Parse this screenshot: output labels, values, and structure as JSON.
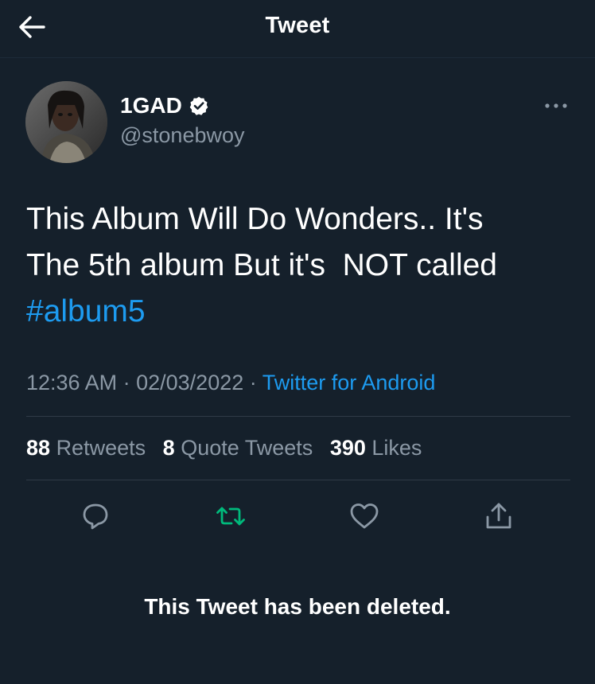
{
  "header": {
    "title": "Tweet",
    "back_icon": "arrow-left-icon"
  },
  "author": {
    "display_name": "1GAD",
    "handle": "@stonebwoy",
    "verified": true,
    "verified_icon": "verified-badge-icon"
  },
  "tweet": {
    "text_line_1": "This Album Will Do Wonders.. It's",
    "text_line_2": "The 5th album But it's  NOT called",
    "hashtag": "#album5"
  },
  "meta": {
    "time": "12:36 AM",
    "separator": "·",
    "date": "02/03/2022",
    "source": "Twitter for Android"
  },
  "stats": {
    "retweets_count": "88",
    "retweets_label": "Retweets",
    "quotes_count": "8",
    "quotes_label": "Quote Tweets",
    "likes_count": "390",
    "likes_label": "Likes"
  },
  "actions": {
    "reply_icon": "reply-icon",
    "retweet_icon": "retweet-icon",
    "like_icon": "heart-icon",
    "share_icon": "share-icon"
  },
  "notice": {
    "deleted_text": "This Tweet has been deleted."
  },
  "colors": {
    "background": "#15202b",
    "accent": "#1d9bf0",
    "muted": "#8b98a5",
    "retweet_green": "#00ba7c"
  }
}
